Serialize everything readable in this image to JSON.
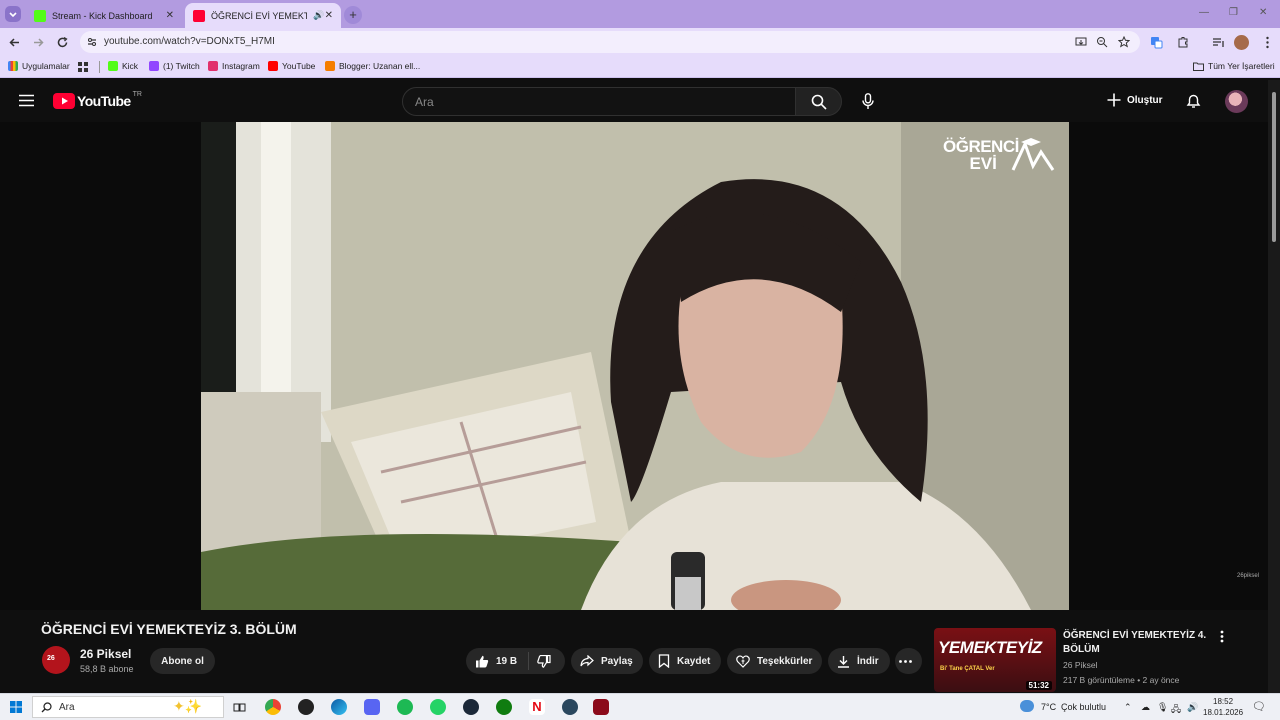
{
  "browser": {
    "tabs": [
      {
        "title": "Stream - Kick Dashboard",
        "favicon_color": "#53fc18"
      },
      {
        "title": "ÖĞRENCİ EVİ YEMEKTEYİZ",
        "favicon_color": "#ff0033"
      }
    ],
    "new_tab_glyph": "+",
    "url": "youtube.com/watch?v=DONxT5_H7MI",
    "bookmarks": [
      {
        "label": "Uygulamalar",
        "icon": "apps-icon"
      },
      {
        "label": "Kick",
        "color": "#53fc18"
      },
      {
        "label": "(1) Twitch",
        "color": "#9146ff"
      },
      {
        "label": "Instagram",
        "color": "#e1306c"
      },
      {
        "label": "YouTube",
        "color": "#ff0000"
      },
      {
        "label": "Blogger: Uzanan ell...",
        "color": "#f57d00"
      }
    ],
    "all_bookmarks": "Tüm Yer İşaretleri",
    "accent": "#b29be0"
  },
  "youtube": {
    "logo_text": "YouTube",
    "country_code": "TR",
    "search_placeholder": "Ara",
    "create_label": "Oluştur",
    "watermark_line1": "ÖĞRENCİ",
    "watermark_line2": "EVİ",
    "corner_watermark": "26piksel",
    "video_title": "ÖĞRENCİ EVİ YEMEKTEYİZ 3. BÖLÜM",
    "channel_name": "26 Piksel",
    "subscribers": "58,8 B abone",
    "subscribe_label": "Abone ol",
    "likes": "19 B",
    "share_label": "Paylaş",
    "save_label": "Kaydet",
    "thanks_label": "Teşekkürler",
    "download_label": "İndir",
    "related": {
      "title_line1": "ÖĞRENCİ EVİ YEMEKTEYİZ 4.",
      "title_line2": "BÖLÜM",
      "channel": "26 Piksel",
      "meta": "217 B görüntüleme • 2 ay önce",
      "duration": "51:32",
      "thumb_text": "YEMEKTEYİZ",
      "thumb_subtext": "Bi' Tane ÇATAL Ver"
    }
  },
  "taskbar": {
    "search_placeholder": "Ara",
    "weather": "7°C",
    "weather_desc": "Çok bulutlu",
    "time": "18:52",
    "date": "18.01.2026"
  }
}
